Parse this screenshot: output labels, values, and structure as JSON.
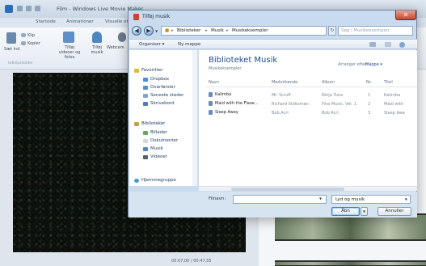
{
  "movie_maker": {
    "title": "Film - Windows Live Movie Maker",
    "tabs": [
      "Startside",
      "Animationer",
      "Visuelle effe"
    ],
    "ribbon": {
      "paste_label": "Sæt ind",
      "cut_label": "Klip",
      "copy_label": "Kopier",
      "add_videos_label": "Tilføj videoer og fotos",
      "add_music_label": "Tilføj musik",
      "webcam_label": "Webcam",
      "group_label": "Udklipsholder"
    },
    "time_readout": "00:07,00 / 00:47,55"
  },
  "dialog": {
    "title": "Tilføj musik",
    "close": "✕",
    "address": {
      "root": "Biblioteker",
      "level1": "Musik",
      "level2": "Musikeksempler"
    },
    "search_placeholder": "Søg i Musikeksempler",
    "toolbar": {
      "organize": "Organiser ▾",
      "new_folder": "Ny mappe"
    },
    "nav": {
      "favorites": "Favoritter",
      "dropbox": "Dropbox",
      "downloads": "Overførsler",
      "recent": "Seneste steder",
      "desktop": "Skrivebord",
      "libraries": "Biblioteker",
      "pictures": "Billeder",
      "documents": "Dokumenter",
      "music": "Musik",
      "videos": "Videoer",
      "homegroup": "Hjemmegruppe"
    },
    "library": {
      "title": "Biblioteket Musik",
      "subtitle": "Musikeksempler",
      "arrange_label": "Arranger efter:",
      "arrange_value": "Mappe ▾"
    },
    "columns": [
      "Navn",
      "Medvirkende",
      "Album",
      "Nr.",
      "Titel"
    ],
    "rows": [
      {
        "name": "Kalimba",
        "artist": "Mr. Scruff",
        "album": "Ninja Tuna",
        "nr": "1",
        "title": "Kalimba"
      },
      {
        "name": "Maid with the Flaxe...",
        "artist": "Richard Stoltzman",
        "album": "Fine Music, Vol. 1",
        "nr": "2",
        "title": "Maid with"
      },
      {
        "name": "Sleep Away",
        "artist": "Bob Acri",
        "album": "Bob Acri",
        "nr": "3",
        "title": "Sleep Awa"
      }
    ],
    "filename_label": "Filnavn:",
    "filter_value": "Lyd og musik",
    "open_button": "Åbn",
    "cancel_button": "Annuller"
  }
}
